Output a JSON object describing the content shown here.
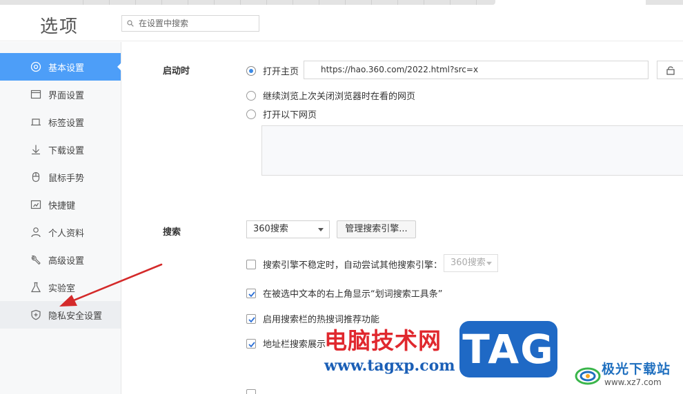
{
  "header": {
    "title": "选项",
    "search_placeholder": "在设置中搜索"
  },
  "sidebar": {
    "items": [
      {
        "label": "基本设置",
        "icon": "settings-circle-icon",
        "active": true
      },
      {
        "label": "界面设置",
        "icon": "window-icon"
      },
      {
        "label": "标签设置",
        "icon": "tab-icon"
      },
      {
        "label": "下载设置",
        "icon": "download-icon"
      },
      {
        "label": "鼠标手势",
        "icon": "mouse-icon"
      },
      {
        "label": "快捷键",
        "icon": "shortcut-icon"
      },
      {
        "label": "个人资料",
        "icon": "person-icon"
      },
      {
        "label": "高级设置",
        "icon": "wrench-icon"
      },
      {
        "label": "实验室",
        "icon": "flask-icon"
      },
      {
        "label": "隐私安全设置",
        "icon": "shield-icon",
        "hover": true
      }
    ]
  },
  "startup": {
    "label": "启动时",
    "options": [
      {
        "label": "打开主页",
        "selected": true
      },
      {
        "label": "继续浏览上次关闭浏览器时在看的网页",
        "selected": false
      },
      {
        "label": "打开以下网页",
        "selected": false
      }
    ],
    "homepage_url": "https://hao.360.com/2022.html?src=x"
  },
  "search": {
    "label": "搜索",
    "engine": "360搜索",
    "manage_button": "管理搜索引擎...",
    "fallback_label": "搜索引擎不稳定时，自动尝试其他搜索引擎：",
    "fallback_engine": "360搜索",
    "options": [
      {
        "label": "搜索引擎不稳定时，自动尝试其他搜索引擎：",
        "checked": false
      },
      {
        "label": "在被选中文本的右上角显示“划词搜索工具条”",
        "checked": true
      },
      {
        "label": "启用搜索栏的热搜词推荐功能",
        "checked": true
      },
      {
        "label": "地址栏搜索展示",
        "checked": true
      }
    ]
  },
  "watermark": {
    "site_title": "电脑技术网",
    "site_url": "www.tagxp.com",
    "badge": "TAG",
    "brand_name": "极光下载站",
    "brand_url": "www.xz7.com"
  },
  "colors": {
    "accent": "#4d9ef8",
    "watermark_red": "#e0282e",
    "watermark_blue": "#1f69c5",
    "arrow_red": "#d42a2a"
  }
}
